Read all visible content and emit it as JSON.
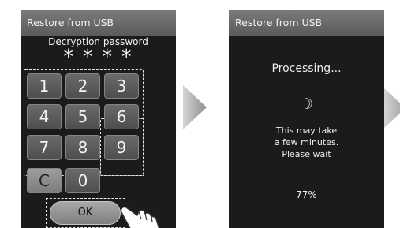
{
  "screen1": {
    "title": "Restore from USB",
    "password_label": "Decryption password",
    "password_mask": "****",
    "keys": [
      "1",
      "2",
      "3",
      "4",
      "5",
      "6",
      "7",
      "8",
      "9",
      "C",
      "0"
    ],
    "ok_label": "OK"
  },
  "screen2": {
    "title": "Restore from USB",
    "status": "Processing...",
    "spinner": "☽",
    "message_lines": [
      "This may take",
      "a few minutes.",
      "Please wait"
    ],
    "progress": "77%"
  },
  "icons": {
    "next_arrow": "triangle-right-icon",
    "pointer": "pointing-hand-icon"
  },
  "colors": {
    "screen_bg": "#1c1b1b",
    "titlebar": "#6a6a6a",
    "key": "#5b5b5b",
    "arrow": "#a9a9a9"
  }
}
